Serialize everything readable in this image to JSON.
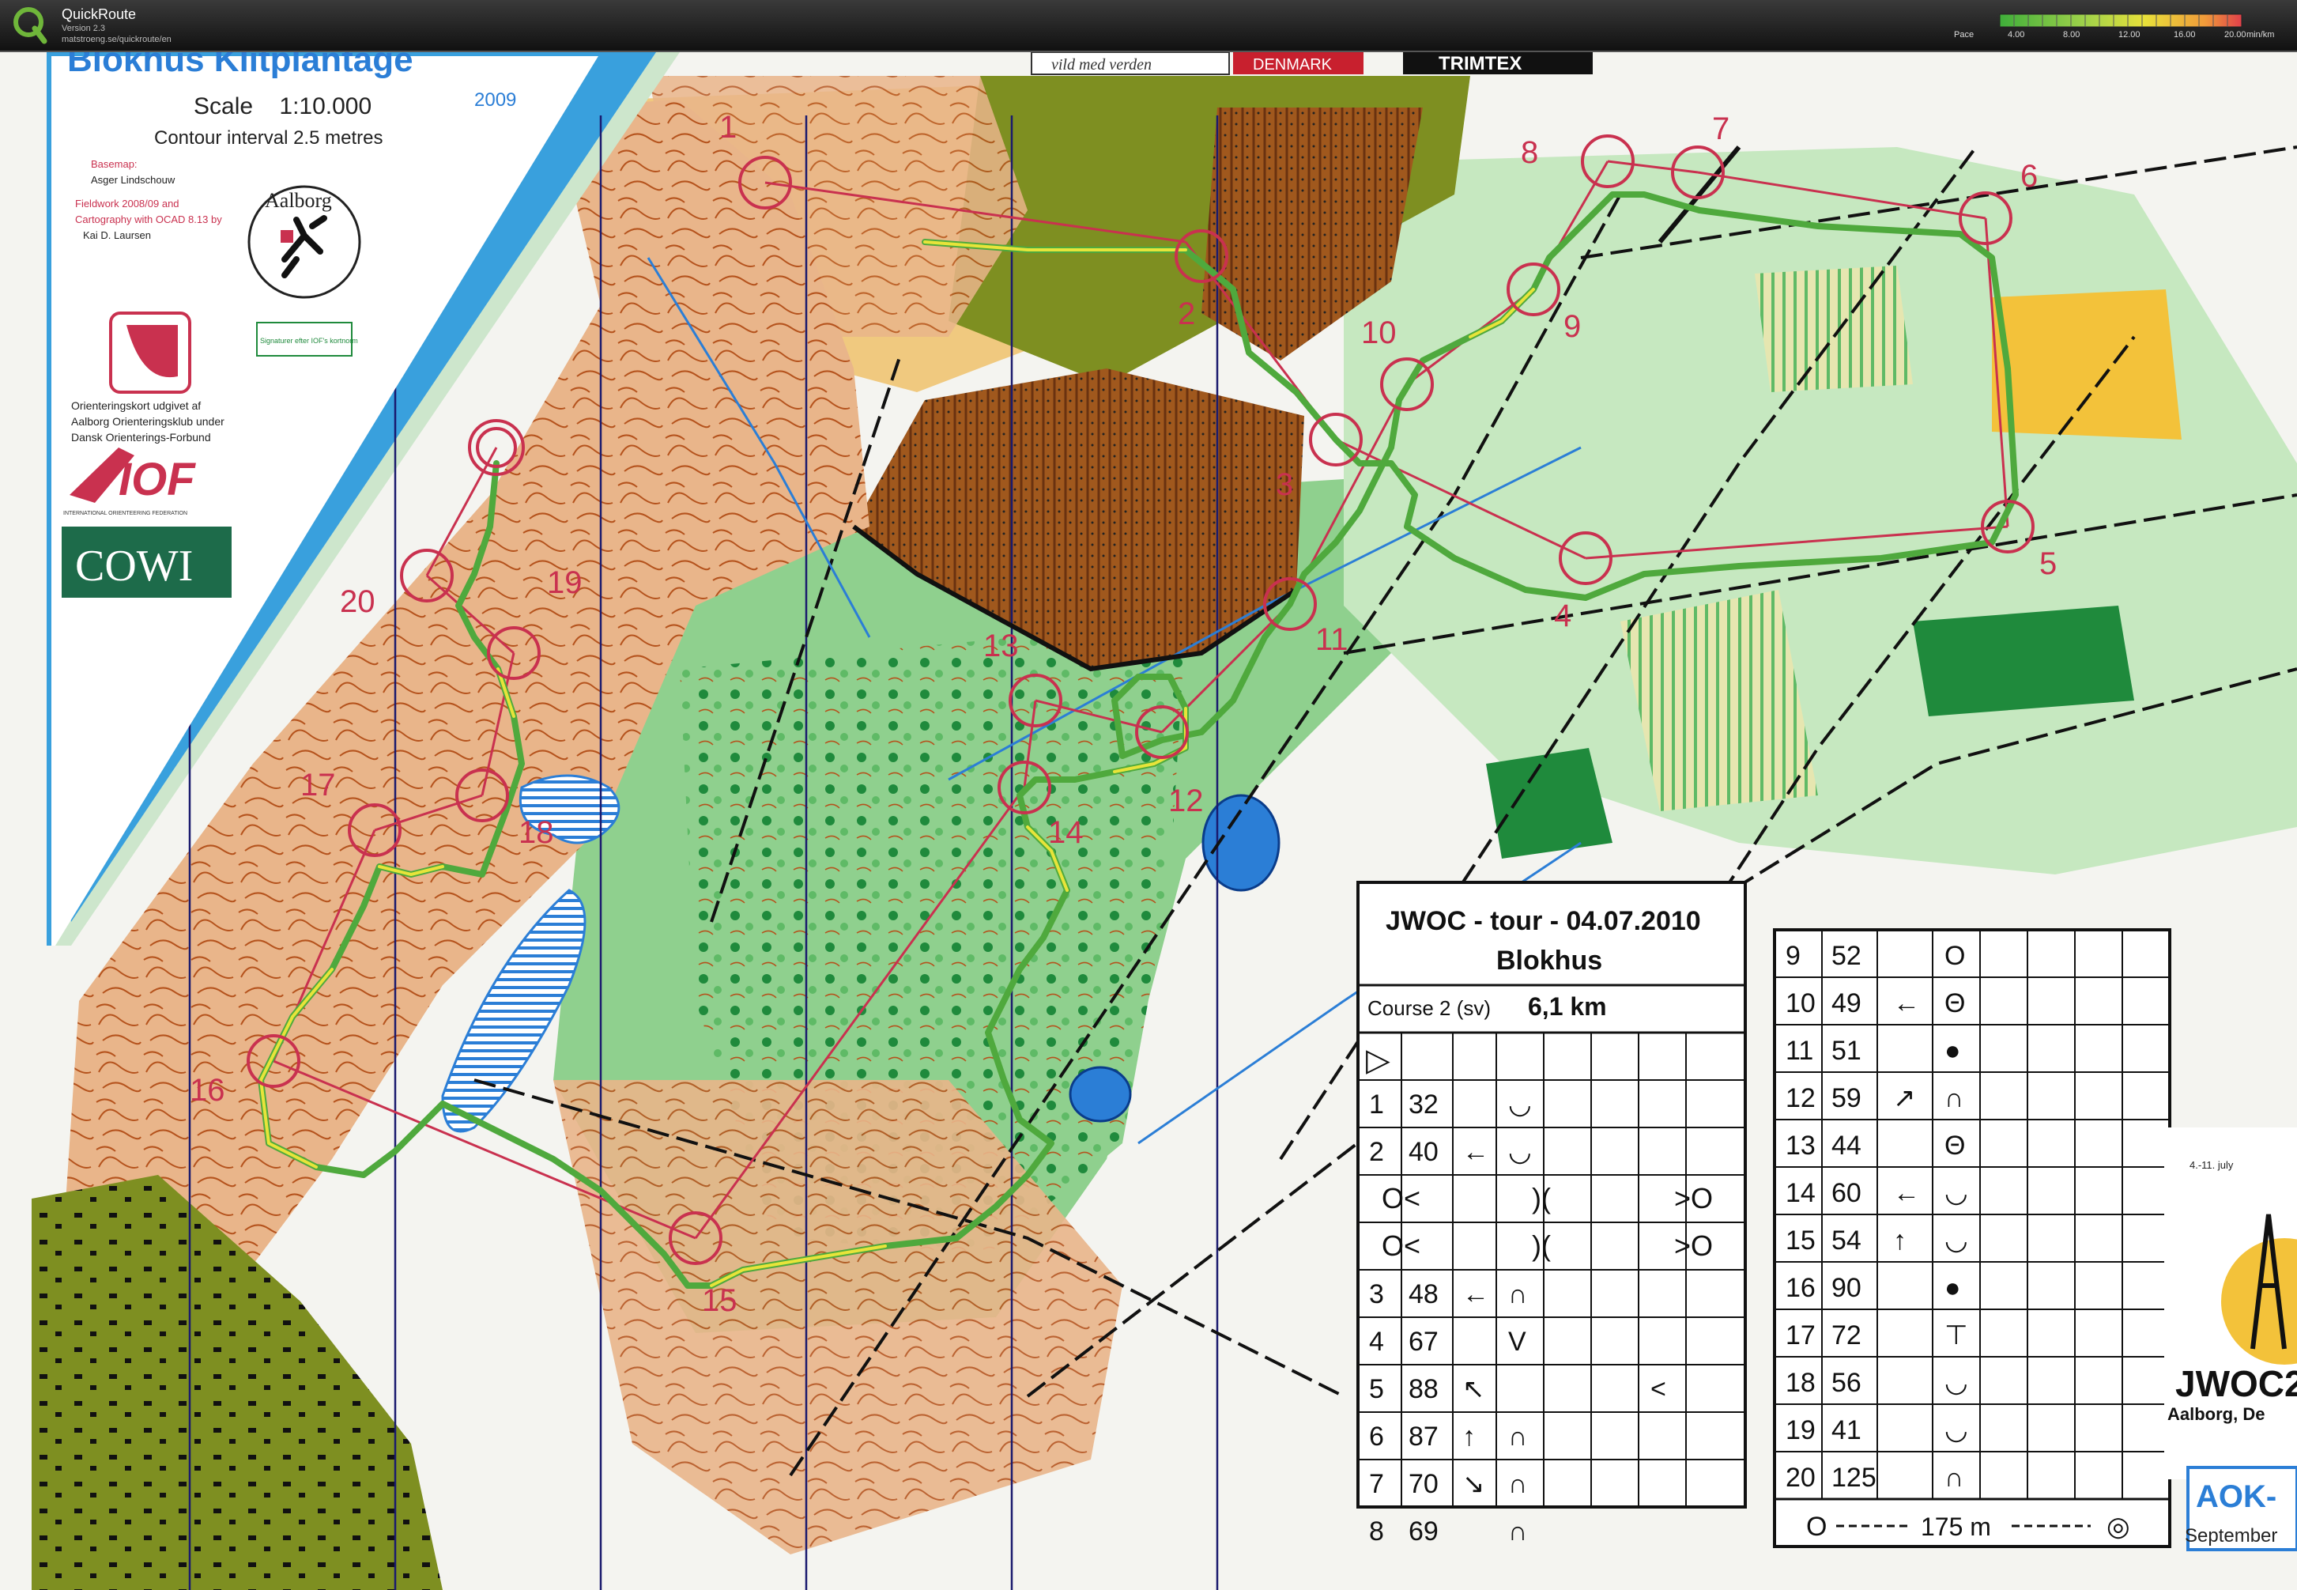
{
  "app": {
    "title": "QuickRoute",
    "version": "Version 2.3",
    "url": "matstroeng.se/quickroute/en"
  },
  "pace_legend": {
    "label": "Pace",
    "unit": "min/km",
    "ticks": [
      "4.00",
      "8.00",
      "12.00",
      "16.00",
      "20.00"
    ]
  },
  "map_header": {
    "title": "Blokhus Klitplantage",
    "scale": "Scale    1:10.000",
    "year": "2009",
    "contour": "Contour interval 2.5 metres",
    "club_logo": "Aalborg",
    "basemap_lines": [
      "Basemap:",
      "Asger Lindschouw",
      "Fieldwork 2008/09 and",
      "Cartography with OCAD 8.13 by",
      "Kai D. Laursen"
    ],
    "publisher_lines": [
      "Orienteringskort udgivet af",
      "Aalborg Orienteringsklub under",
      "Dansk Orienterings-Forbund"
    ],
    "signature_note": "Signaturer efter IOF's kortnorm",
    "iof_text": "IOF",
    "iof_sub": "INTERNATIONAL ORIENTEERING FEDERATION",
    "cowi_text": "COWI",
    "sponsor_banner_1": "vild med verden",
    "sponsor_banner_2": "DENMARK",
    "sponsor_banner_3": "TRIMTEX"
  },
  "controls": [
    {
      "num": "1"
    },
    {
      "num": "2"
    },
    {
      "num": "3"
    },
    {
      "num": "4"
    },
    {
      "num": "5"
    },
    {
      "num": "6"
    },
    {
      "num": "7"
    },
    {
      "num": "8"
    },
    {
      "num": "9"
    },
    {
      "num": "10"
    },
    {
      "num": "11"
    },
    {
      "num": "12"
    },
    {
      "num": "13"
    },
    {
      "num": "14"
    },
    {
      "num": "15"
    },
    {
      "num": "16"
    },
    {
      "num": "17"
    },
    {
      "num": "18"
    },
    {
      "num": "19"
    },
    {
      "num": "20"
    }
  ],
  "description_card": {
    "title": "JWOC - tour - 04.07.2010",
    "subtitle": "Blokhus",
    "course": "Course 2 (sv)",
    "length": "6,1 km",
    "rows_left": [
      {
        "n": "1",
        "code": "32",
        "dir": "",
        "sym": "◡"
      },
      {
        "n": "2",
        "code": "40",
        "dir": "←",
        "sym": "◡"
      },
      {
        "n": "3",
        "code": "48",
        "dir": "←",
        "sym": "∩"
      },
      {
        "n": "4",
        "code": "67",
        "dir": "",
        "sym": "V"
      },
      {
        "n": "5",
        "code": "88",
        "dir": "↖",
        "sym": "",
        "extra": "<"
      },
      {
        "n": "6",
        "code": "87",
        "dir": "↑",
        "sym": "∩"
      },
      {
        "n": "7",
        "code": "70",
        "dir": "↘",
        "sym": "∩"
      },
      {
        "n": "8",
        "code": "69",
        "dir": "",
        "sym": "∩"
      }
    ],
    "rows_right": [
      {
        "n": "9",
        "code": "52",
        "dir": "",
        "sym": "O"
      },
      {
        "n": "10",
        "code": "49",
        "dir": "←",
        "sym": "Θ"
      },
      {
        "n": "11",
        "code": "51",
        "dir": "",
        "sym": "●"
      },
      {
        "n": "12",
        "code": "59",
        "dir": "↗",
        "sym": "∩"
      },
      {
        "n": "13",
        "code": "44",
        "dir": "",
        "sym": "Θ"
      },
      {
        "n": "14",
        "code": "60",
        "dir": "←",
        "sym": "◡"
      },
      {
        "n": "15",
        "code": "54",
        "dir": "↑",
        "sym": "◡"
      },
      {
        "n": "16",
        "code": "90",
        "dir": "",
        "sym": "●"
      },
      {
        "n": "17",
        "code": "72",
        "dir": "",
        "sym": "⊤"
      },
      {
        "n": "18",
        "code": "56",
        "dir": "",
        "sym": "◡"
      },
      {
        "n": "19",
        "code": "41",
        "dir": "",
        "sym": "◡"
      },
      {
        "n": "20",
        "code": "125",
        "dir": "",
        "sym": "∩"
      }
    ],
    "finish": "175 m"
  },
  "event_poster": {
    "dates": "4.-11. july",
    "logo": "JWOC2",
    "city": "Aalborg, De",
    "club": "AOK-",
    "month": "September"
  },
  "colors": {
    "forest_white": "#f4f4f0",
    "green_light": "#8fd08e",
    "green_dark": "#1f8a3c",
    "open_yellow": "#f0c97f",
    "sand": "#e9b58a",
    "contour": "#b5531d",
    "water": "#2b7ed6",
    "route_green": "#4fa93d",
    "route_yellow": "#e7e43a",
    "control_red": "#c9314f",
    "olive": "#7e8f21"
  }
}
